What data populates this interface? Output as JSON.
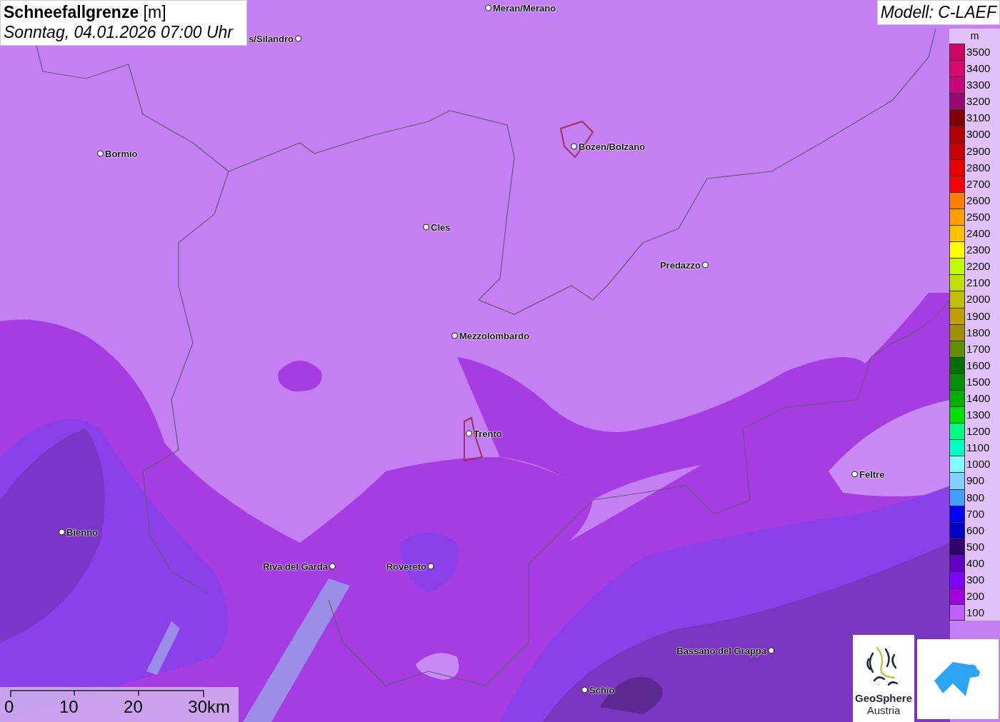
{
  "title": {
    "parameter": "Schneefallgrenze",
    "unit": "[m]",
    "time": "Sonntag, 04.01.2026 07:00 Uhr"
  },
  "model": "Modell: C-LAEF",
  "towns": [
    {
      "name": "Meran/Merano"
    },
    {
      "name": "s/Silandro"
    },
    {
      "name": "Bormio"
    },
    {
      "name": "Bozen/Bolzano"
    },
    {
      "name": "Cles"
    },
    {
      "name": "Predazzo"
    },
    {
      "name": "Mezzolombardo"
    },
    {
      "name": "Trento"
    },
    {
      "name": "Feltre"
    },
    {
      "name": "Bienno"
    },
    {
      "name": "Riva del Garda"
    },
    {
      "name": "Rovereto"
    },
    {
      "name": "Bassano del Grappa"
    },
    {
      "name": "Schio"
    }
  ],
  "legend": {
    "unit": "m",
    "entries": [
      {
        "label": "3500",
        "color": "#cc0660"
      },
      {
        "label": "3400",
        "color": "#d80a6e"
      },
      {
        "label": "3300",
        "color": "#c8087a"
      },
      {
        "label": "3200",
        "color": "#980a70"
      },
      {
        "label": "3100",
        "color": "#800000"
      },
      {
        "label": "3000",
        "color": "#b00000"
      },
      {
        "label": "2900",
        "color": "#c80000"
      },
      {
        "label": "2800",
        "color": "#e40000"
      },
      {
        "label": "2700",
        "color": "#ff0000"
      },
      {
        "label": "2600",
        "color": "#ff8000"
      },
      {
        "label": "2500",
        "color": "#ffa000"
      },
      {
        "label": "2400",
        "color": "#ffc000"
      },
      {
        "label": "2300",
        "color": "#ffff00"
      },
      {
        "label": "2200",
        "color": "#c0ff00"
      },
      {
        "label": "2100",
        "color": "#c0e000"
      },
      {
        "label": "2000",
        "color": "#c0c000"
      },
      {
        "label": "1900",
        "color": "#c0a000"
      },
      {
        "label": "1800",
        "color": "#a09000"
      },
      {
        "label": "1700",
        "color": "#609000"
      },
      {
        "label": "1600",
        "color": "#007000"
      },
      {
        "label": "1500",
        "color": "#009000"
      },
      {
        "label": "1400",
        "color": "#00b000"
      },
      {
        "label": "1300",
        "color": "#00e000"
      },
      {
        "label": "1200",
        "color": "#00ff80"
      },
      {
        "label": "1100",
        "color": "#00ffc0"
      },
      {
        "label": "1000",
        "color": "#80ffff"
      },
      {
        "label": "900",
        "color": "#80d0ff"
      },
      {
        "label": "800",
        "color": "#40a0ff"
      },
      {
        "label": "700",
        "color": "#0000ff"
      },
      {
        "label": "600",
        "color": "#0000c0"
      },
      {
        "label": "500",
        "color": "#300070"
      },
      {
        "label": "400",
        "color": "#6000c0"
      },
      {
        "label": "300",
        "color": "#8000ff"
      },
      {
        "label": "200",
        "color": "#a000e0"
      },
      {
        "label": "100",
        "color": "#c060ff"
      }
    ]
  },
  "scale_bar": {
    "ticks": [
      "0",
      "10",
      "20",
      "30km"
    ]
  },
  "logo": {
    "line1": "GeoSphere",
    "line2": "Austria"
  }
}
